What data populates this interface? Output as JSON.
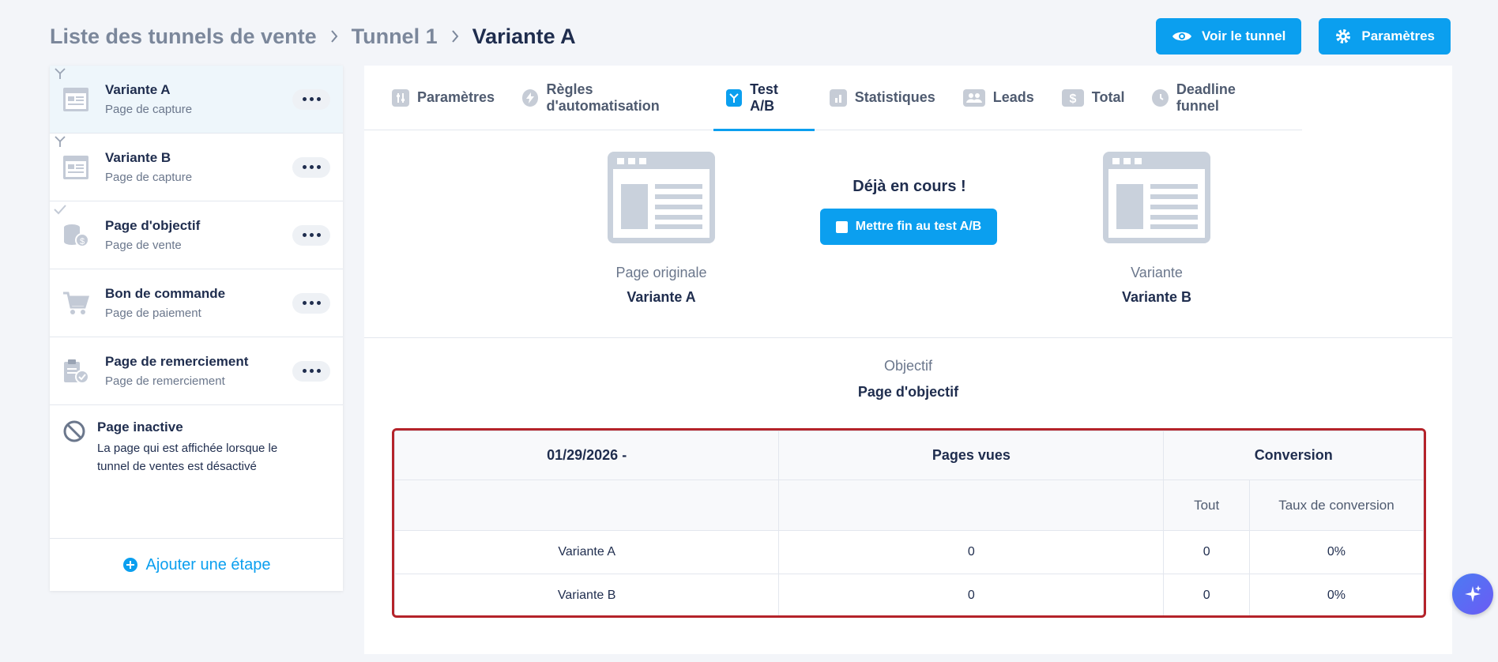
{
  "breadcrumb": [
    "Liste des tunnels de vente",
    "Tunnel 1",
    "Variante A"
  ],
  "header_actions": {
    "view_label": "Voir le tunnel",
    "settings_label": "Paramètres"
  },
  "sidebar": {
    "steps": [
      {
        "title": "Variante A",
        "subtitle": "Page de capture",
        "icon": "capture-page-icon",
        "marker": "split-icon",
        "selected": true
      },
      {
        "title": "Variante B",
        "subtitle": "Page de capture",
        "icon": "capture-page-icon",
        "marker": "split-icon"
      },
      {
        "title": "Page d'objectif",
        "subtitle": "Page de vente",
        "icon": "coins-icon",
        "marker": "check-icon"
      },
      {
        "title": "Bon de commande",
        "subtitle": "Page de paiement",
        "icon": "cart-icon"
      },
      {
        "title": "Page de remerciement",
        "subtitle": "Page de remerciement",
        "icon": "clipboard-check-icon"
      }
    ],
    "inactive": {
      "title": "Page inactive",
      "description": "La page qui est affichée lorsque le tunnel de ventes est désactivé"
    },
    "add_step_label": "Ajouter une étape"
  },
  "tabs": [
    {
      "label": "Paramètres",
      "icon": "sliders-icon"
    },
    {
      "label": "Règles d'automatisation",
      "icon": "lightning-icon"
    },
    {
      "label": "Test A/B",
      "icon": "split-icon",
      "active": true
    },
    {
      "label": "Statistiques",
      "icon": "bar-chart-icon"
    },
    {
      "label": "Leads",
      "icon": "users-icon"
    },
    {
      "label": "Total",
      "icon": "dollar-icon"
    },
    {
      "label": "Deadline funnel",
      "icon": "clock-icon"
    }
  ],
  "ab_test": {
    "original": {
      "label": "Page originale",
      "name": "Variante A"
    },
    "variant": {
      "label": "Variante",
      "name": "Variante B"
    },
    "status": "Déjà en cours !",
    "end_button": "Mettre fin au test A/B",
    "objective": {
      "label": "Objectif",
      "name": "Page d'objectif"
    }
  },
  "table": {
    "date": "01/29/2026 -",
    "pages_vues": "Pages vues",
    "conversion": "Conversion",
    "sub_all": "Tout",
    "sub_rate": "Taux de conversion",
    "rows": [
      {
        "name": "Variante A",
        "views": "0",
        "all": "0",
        "rate": "0%"
      },
      {
        "name": "Variante B",
        "views": "0",
        "all": "0",
        "rate": "0%"
      }
    ]
  },
  "colors": {
    "accent": "#0b9fef",
    "highlight_border": "#b4232a"
  }
}
